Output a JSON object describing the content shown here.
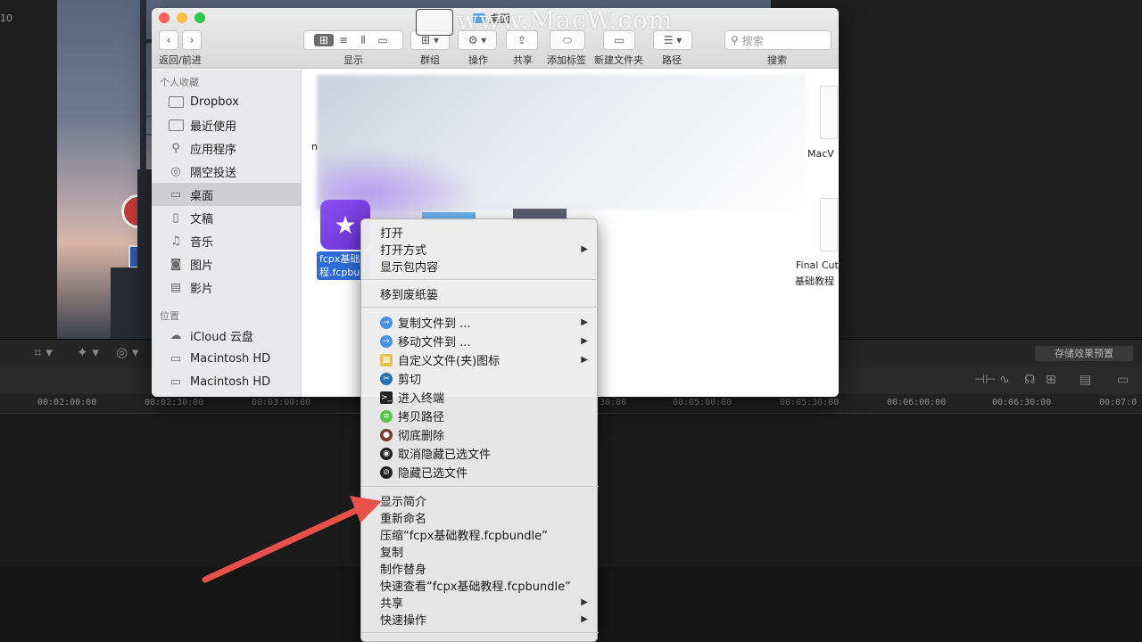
{
  "fcp": {
    "timecode_prefix": "10",
    "save_preset_label": "存储效果预置",
    "ruler_ticks": [
      "00:02:00:00",
      "00:02:30:00",
      "00:03:00:00",
      "30:00",
      "00:05:00:00",
      "00:05:30:00",
      "00:06:00:00",
      "00:06:30:00",
      "00:07:0"
    ]
  },
  "finder": {
    "title": "桌面",
    "toolbar": {
      "back_forward_label": "返回/前进",
      "view_label": "显示",
      "group_label": "群组",
      "action_label": "操作",
      "share_label": "共享",
      "add_tag_label": "添加标签",
      "new_folder_label": "新建文件夹",
      "path_label": "路径",
      "search_label": "搜索",
      "search_placeholder": "搜索"
    },
    "sidebar": {
      "favorites_header": "个人收藏",
      "favorites": [
        {
          "label": "Dropbox",
          "icon": "folder-icon"
        },
        {
          "label": "最近使用",
          "icon": "folder-icon"
        },
        {
          "label": "应用程序",
          "icon": "applications-icon"
        },
        {
          "label": "隔空投送",
          "icon": "airdrop-icon"
        },
        {
          "label": "桌面",
          "icon": "desktop-icon",
          "selected": true
        },
        {
          "label": "文稿",
          "icon": "document-icon"
        },
        {
          "label": "音乐",
          "icon": "music-icon"
        },
        {
          "label": "图片",
          "icon": "camera-icon"
        },
        {
          "label": "影片",
          "icon": "film-icon"
        }
      ],
      "locations_header": "位置",
      "locations": [
        {
          "label": "iCloud 云盘",
          "icon": "cloud-icon"
        },
        {
          "label": "Macintosh HD",
          "icon": "disk-icon"
        },
        {
          "label": "Macintosh HD",
          "icon": "disk-icon"
        }
      ]
    },
    "files": {
      "selected_name_line1": "fcpx基础",
      "selected_name_line2": "程.fcpbu",
      "right_file1": "MacV",
      "right_file2_line1": "Final Cut",
      "right_file2_line2": "基础教程",
      "left_cut": "n"
    }
  },
  "context_menu": {
    "items": [
      {
        "label": "打开"
      },
      {
        "label": "打开方式",
        "submenu": true
      },
      {
        "label": "显示包内容"
      },
      {
        "label": "移到废纸篓"
      },
      {
        "label": "复制文件到 ...",
        "submenu": true,
        "icon": "copy-to-icon",
        "color": "#4a90e2"
      },
      {
        "label": "移动文件到 ...",
        "submenu": true,
        "icon": "move-to-icon",
        "color": "#4a90e2"
      },
      {
        "label": "自定义文件(夹)图标",
        "submenu": true,
        "icon": "custom-icon-icon",
        "color": "#e8c24a"
      },
      {
        "label": "剪切",
        "icon": "scissors-icon",
        "color": "#2a6fb0"
      },
      {
        "label": "进入终端",
        "icon": "terminal-icon",
        "color": "#222222"
      },
      {
        "label": "拷贝路径",
        "icon": "copy-path-icon",
        "color": "#5cc24a"
      },
      {
        "label": "彻底删除",
        "icon": "delete-icon",
        "color": "#7a3a2a"
      },
      {
        "label": "取消隐藏已选文件",
        "icon": "eye-icon",
        "color": "#222222"
      },
      {
        "label": "隐藏已选文件",
        "icon": "eye-slash-icon",
        "color": "#222222"
      },
      {
        "label": "显示简介"
      },
      {
        "label": "重新命名"
      },
      {
        "label": "压缩“fcpx基础教程.fcpbundle”"
      },
      {
        "label": "复制"
      },
      {
        "label": "制作替身"
      },
      {
        "label": "快速查看“fcpx基础教程.fcpbundle”"
      },
      {
        "label": "共享",
        "submenu": true
      },
      {
        "label": "快速操作",
        "submenu": true
      }
    ]
  },
  "watermark": "www.MacW.com",
  "colors": {
    "accent": "#2d6bd6",
    "annotation_arrow": "#e8504a"
  }
}
